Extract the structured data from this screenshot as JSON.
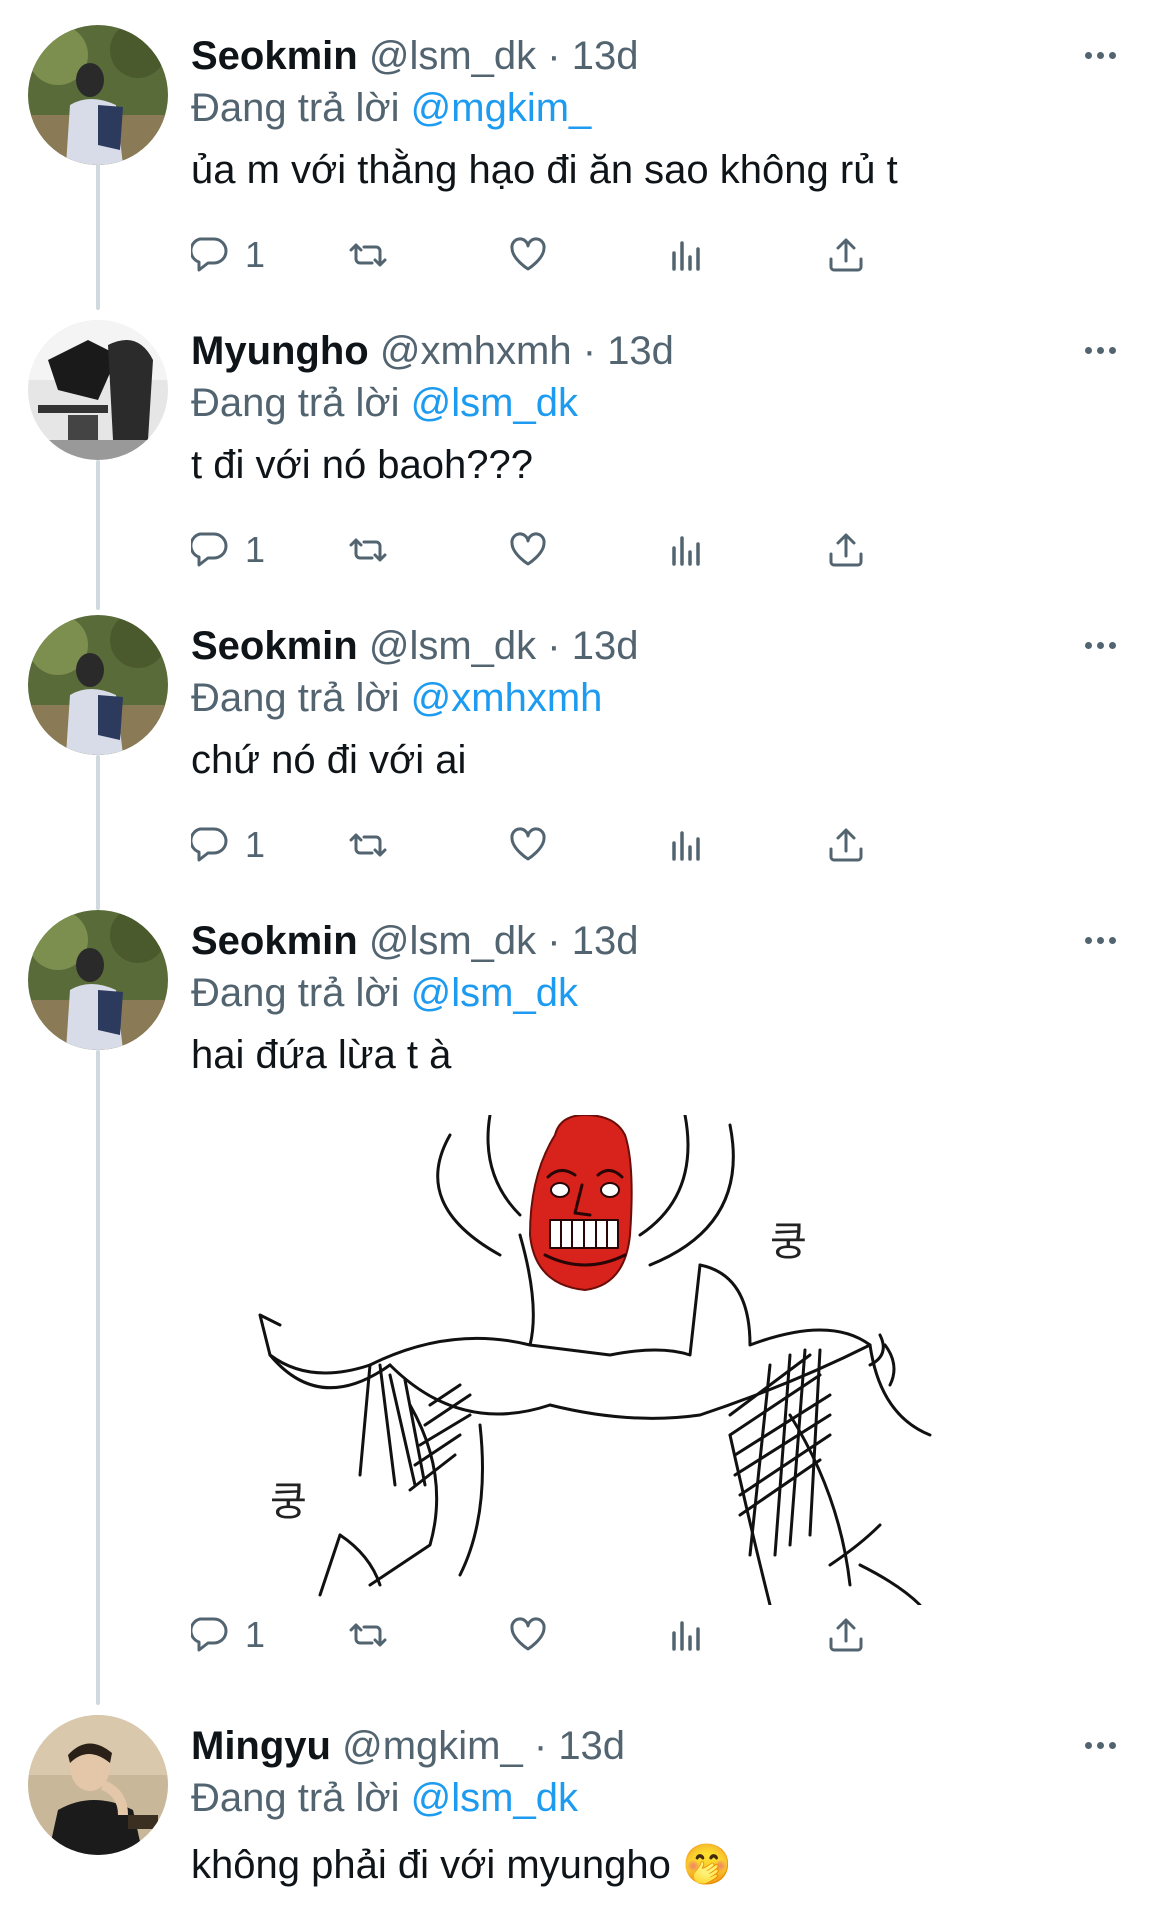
{
  "tweets": [
    {
      "name": "Seokmin",
      "handle": "@lsm_dk",
      "time": "13d",
      "replying_prefix": "Đang trả lời",
      "replying_to": "@mgkim_",
      "text": "ủa m với thằng hạo đi ăn sao không rủ t",
      "reply_count": "1",
      "avatar_icon": "avatar-photo"
    },
    {
      "name": "Myungho",
      "handle": "@xmhxmh",
      "time": "13d",
      "replying_prefix": "Đang trả lời",
      "replying_to": "@lsm_dk",
      "text": "t đi với nó baoh???",
      "reply_count": "1",
      "avatar_icon": "avatar-photo"
    },
    {
      "name": "Seokmin",
      "handle": "@lsm_dk",
      "time": "13d",
      "replying_prefix": "Đang trả lời",
      "replying_to": "@xmhxmh",
      "text": "chứ nó đi với ai",
      "reply_count": "1",
      "avatar_icon": "avatar-photo"
    },
    {
      "name": "Seokmin",
      "handle": "@lsm_dk",
      "time": "13d",
      "replying_prefix": "Đang trả lời",
      "replying_to": "@lsm_dk",
      "text": "hai đứa lừa t à",
      "reply_count": "1",
      "avatar_icon": "avatar-photo",
      "media": {
        "caption_left": "쿵",
        "caption_right": "쿵"
      }
    },
    {
      "name": "Mingyu",
      "handle": "@mgkim_",
      "time": "13d",
      "replying_prefix": "Đang trả lời",
      "replying_to": "@lsm_dk",
      "text": "không phải đi với myungho 🤭",
      "avatar_icon": "avatar-photo"
    }
  ],
  "colors": {
    "link": "#1d9bf0",
    "secondary_text": "#536471",
    "thread_line": "#cfd9de"
  },
  "icons": [
    "reply-icon",
    "retweet-icon",
    "like-icon",
    "views-icon",
    "share-icon",
    "more-icon"
  ]
}
